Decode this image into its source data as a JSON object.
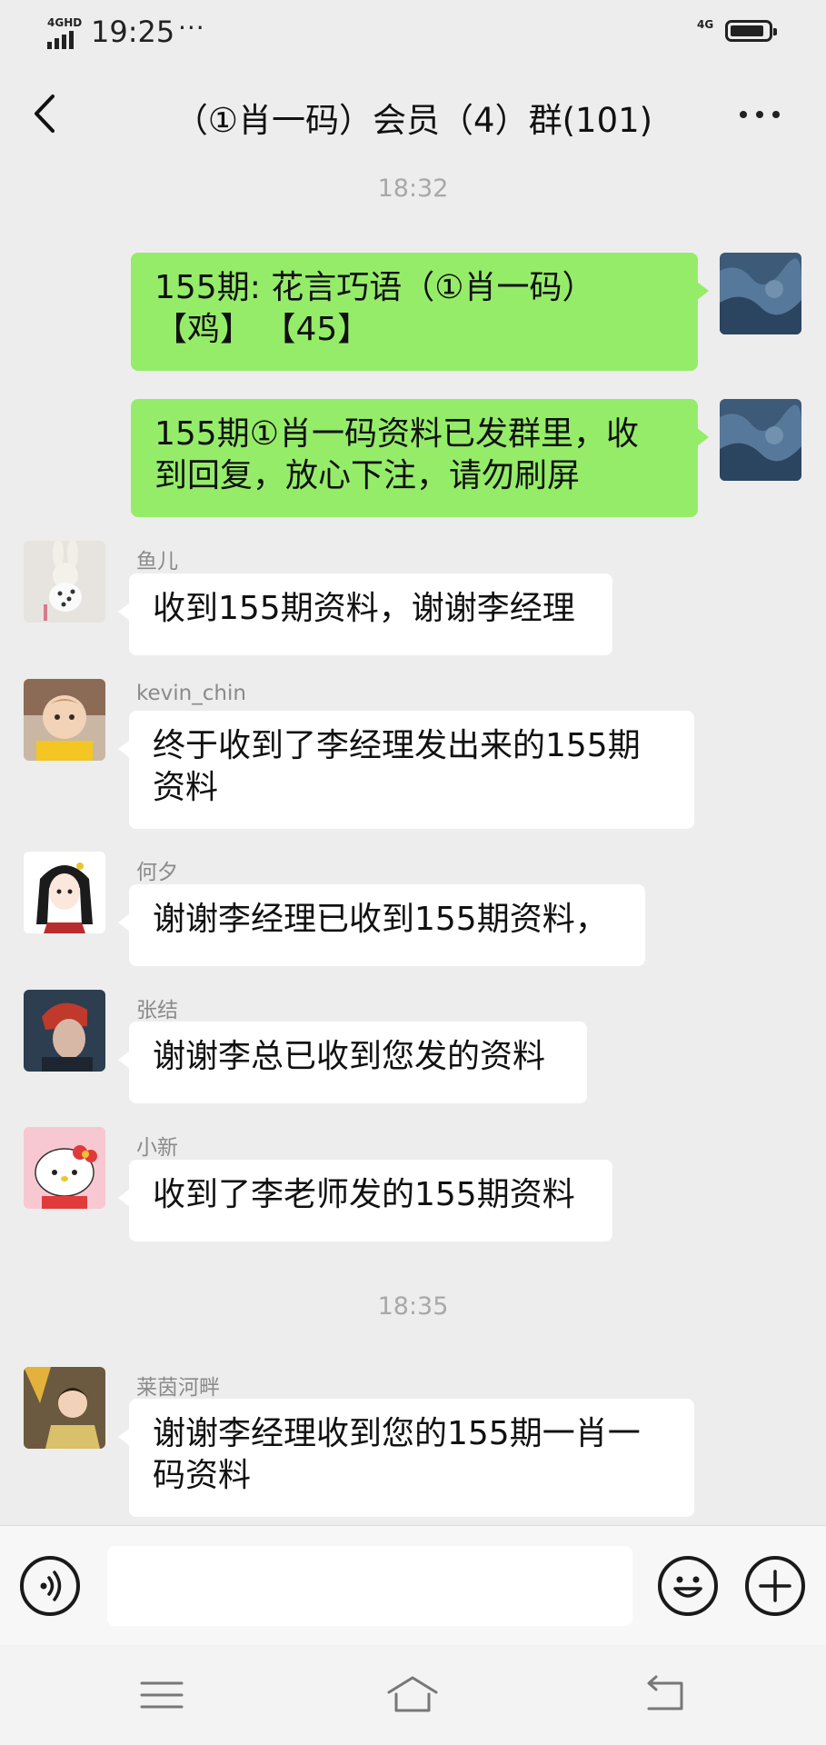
{
  "status_bar": {
    "network": "4GHD",
    "time": "19:25",
    "more": "···",
    "network_right": "4G"
  },
  "header": {
    "title": "（①肖一码）会员（4）群(101)",
    "back_icon": "chevron-left-icon",
    "more_icon": "more-dots-icon"
  },
  "timestamps": [
    "18:32",
    "18:35"
  ],
  "messages": [
    {
      "sender": "",
      "side": "right",
      "lines": [
        "155期: 花言巧语（①肖一码）",
        "【鸡】 【45】"
      ]
    },
    {
      "sender": "",
      "side": "right",
      "lines": [
        "155期①肖一码资料已发群里，收",
        "到回复，放心下注，请勿刷屏"
      ]
    },
    {
      "sender": "鱼儿",
      "side": "left",
      "lines": [
        "收到155期资料，谢谢李经理"
      ]
    },
    {
      "sender": "kevin_chin",
      "side": "left",
      "lines": [
        "终于收到了李经理发出来的155期",
        "资料"
      ]
    },
    {
      "sender": "何夕",
      "side": "left",
      "lines": [
        "谢谢李经理已收到155期资料，"
      ]
    },
    {
      "sender": "张结",
      "side": "left",
      "lines": [
        "谢谢李总已收到您发的资料"
      ]
    },
    {
      "sender": "小新",
      "side": "left",
      "lines": [
        "收到了李老师发的155期资料"
      ]
    },
    {
      "sender": "莱茵河畔",
      "side": "left",
      "lines": [
        "谢谢李经理收到您的155期一肖一",
        "码资料"
      ]
    }
  ],
  "input_bar": {
    "voice_icon": "voice-icon",
    "text_value": "",
    "emoji_icon": "emoji-icon",
    "add_icon": "plus-circle-icon"
  },
  "system_nav": {
    "menu_icon": "menu-icon",
    "home_icon": "home-icon",
    "back_icon": "back-return-icon"
  },
  "colors": {
    "background": "#ededed",
    "my_bubble": "#95ec69",
    "other_bubble": "#ffffff"
  }
}
